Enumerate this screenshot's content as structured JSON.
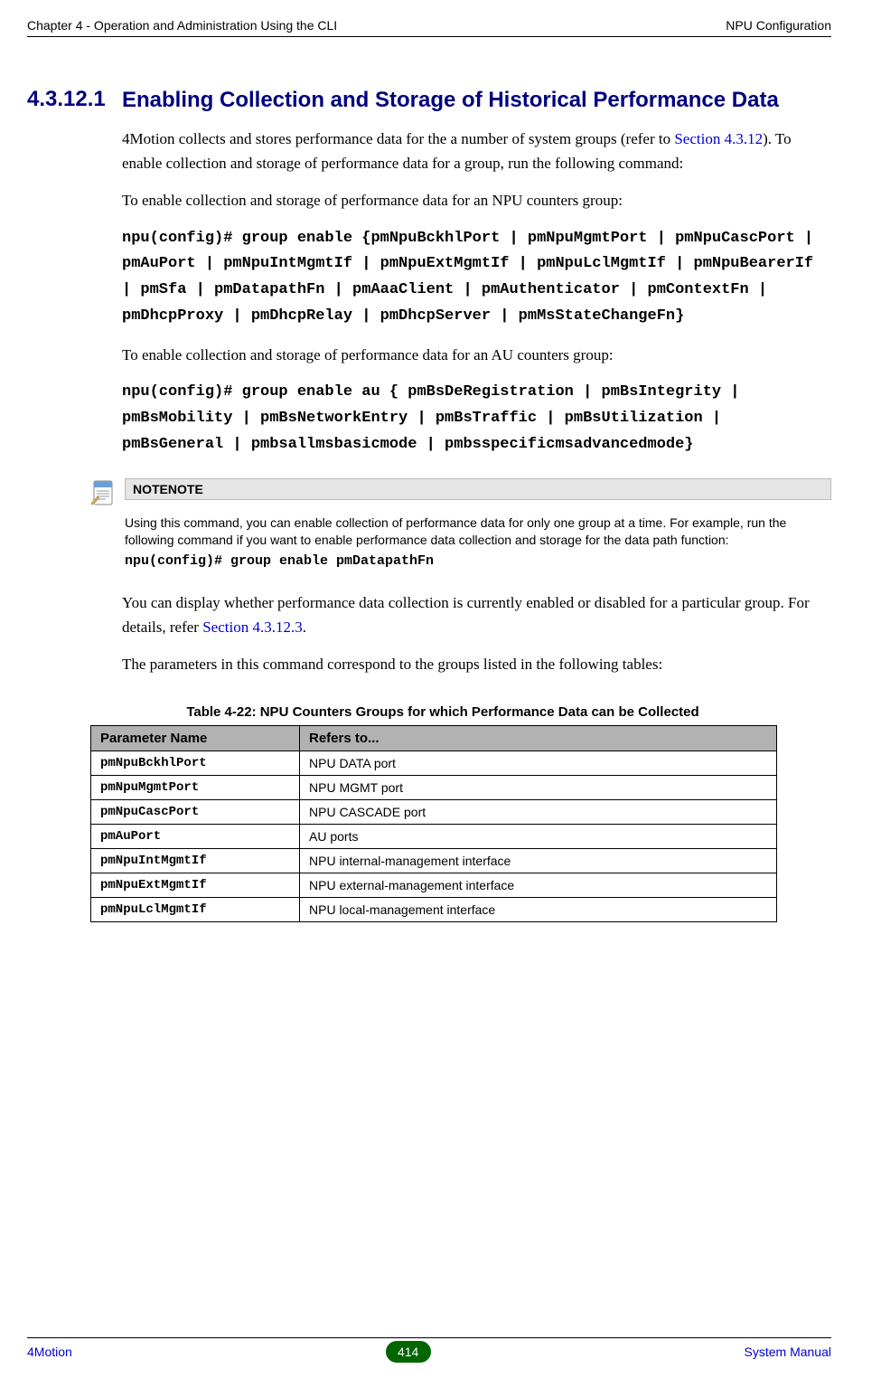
{
  "header": {
    "left": "Chapter 4 - Operation and Administration Using the CLI",
    "right": "NPU Configuration"
  },
  "section": {
    "number": "4.3.12.1",
    "title": "Enabling Collection and Storage of Historical Performance Data"
  },
  "para1_a": "4Motion collects and stores performance data for the a number of system groups (refer to ",
  "para1_link": "Section 4.3.12",
  "para1_b": "). To enable collection and storage of performance data for a group, run the following command:",
  "para2": "To enable collection and storage of performance data for an NPU counters group:",
  "code1": "npu(config)# group enable {pmNpuBckhlPort | pmNpuMgmtPort | pmNpuCascPort | pmAuPort | pmNpuIntMgmtIf | pmNpuExtMgmtIf | pmNpuLclMgmtIf | pmNpuBearerIf | pmSfa | pmDatapathFn | pmAaaClient | pmAuthenticator | pmContextFn | pmDhcpProxy | pmDhcpRelay | pmDhcpServer | pmMsStateChangeFn}",
  "para3": "To enable collection and storage of performance data for an AU counters group:",
  "code2": "npu(config)# group enable au { pmBsDeRegistration | pmBsIntegrity | pmBsMobility | pmBsNetworkEntry | pmBsTraffic | pmBsUtilization | pmBsGeneral | pmbsallmsbasicmode | pmbsspecificmsadvancedmode}",
  "note": {
    "label": "NOTENOTE",
    "body": "Using this command, you can enable collection of performance data for only one group at a time. For example, run the following command if you want to enable performance data collection and storage for the data path function:",
    "code": "npu(config)# group enable pmDatapathFn"
  },
  "para4_a": "You can display whether performance data collection is currently enabled or disabled for a particular group. For details, refer ",
  "para4_link": "Section 4.3.12.3",
  "para4_b": ".",
  "para5": "The parameters in this command correspond to the groups listed in the following tables:",
  "table": {
    "caption": "Table 4-22: NPU Counters Groups for which Performance Data can be Collected",
    "headers": {
      "h1": "Parameter Name",
      "h2": "Refers to..."
    },
    "rows": [
      {
        "p": "pmNpuBckhlPort",
        "d": "NPU DATA port"
      },
      {
        "p": "pmNpuMgmtPort",
        "d": "NPU MGMT port"
      },
      {
        "p": "pmNpuCascPort",
        "d": "NPU CASCADE port"
      },
      {
        "p": "pmAuPort",
        "d": "AU ports"
      },
      {
        "p": "pmNpuIntMgmtIf",
        "d": "NPU internal-management interface"
      },
      {
        "p": "pmNpuExtMgmtIf",
        "d": "NPU external-management interface"
      },
      {
        "p": "pmNpuLclMgmtIf",
        "d": "NPU local-management interface"
      }
    ]
  },
  "footer": {
    "left": "4Motion",
    "page": "414",
    "right": "System Manual"
  }
}
